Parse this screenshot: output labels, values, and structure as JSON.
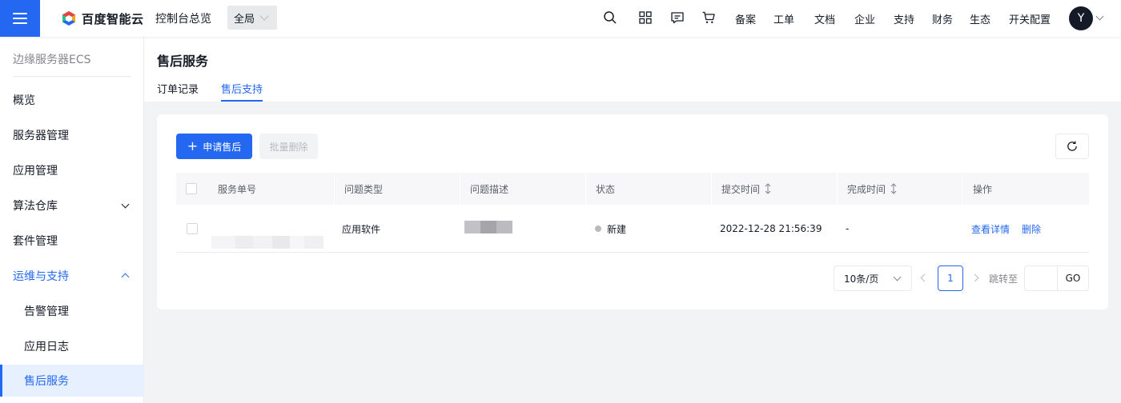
{
  "topbar": {
    "brand": "百度智能云",
    "console_link": "控制台总览",
    "region": "全局",
    "nav_links": [
      "备案",
      "工单",
      "文档",
      "企业",
      "支持",
      "财务",
      "生态",
      "开关配置"
    ],
    "avatar_initial": "Y",
    "brand_colors": [
      "#2468f2",
      "#f5a623",
      "#2ac18b",
      "#e8453c"
    ]
  },
  "sidebar": {
    "title": "边缘服务器ECS",
    "items": [
      {
        "label": "概览"
      },
      {
        "label": "服务器管理"
      },
      {
        "label": "应用管理"
      },
      {
        "label": "算法仓库",
        "expandable": true,
        "expanded": false
      },
      {
        "label": "套件管理"
      },
      {
        "label": "运维与支持",
        "expandable": true,
        "expanded": true
      },
      {
        "label": "告警管理",
        "sub": true
      },
      {
        "label": "应用日志",
        "sub": true
      },
      {
        "label": "售后服务",
        "sub": true,
        "active": true
      }
    ]
  },
  "page": {
    "title": "售后服务",
    "tabs": [
      {
        "label": "订单记录",
        "active": false
      },
      {
        "label": "售后支持",
        "active": true
      }
    ]
  },
  "toolbar": {
    "apply_label": "申请售后",
    "batch_delete_label": "批量删除"
  },
  "table": {
    "columns": [
      "服务单号",
      "问题类型",
      "问题描述",
      "状态",
      "提交时间",
      "完成时间",
      "操作"
    ],
    "rows": [
      {
        "id": "",
        "type": "应用软件",
        "description": "",
        "status": "新建",
        "submitted": "2022-12-28 21:56:39",
        "completed": "-",
        "actions": [
          "查看详情",
          "删除"
        ]
      }
    ]
  },
  "pagination": {
    "page_size": "10条/页",
    "current_page": "1",
    "jump_label": "跳转至",
    "go_label": "GO"
  },
  "colors": {
    "accent": "#2468f2",
    "status_new": "#b8babf"
  }
}
